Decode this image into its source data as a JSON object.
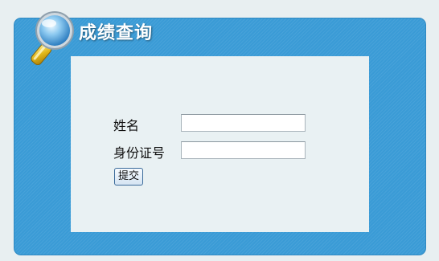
{
  "header": {
    "title": "成绩查询",
    "icon": "magnifier-icon"
  },
  "form": {
    "name_label": "姓名",
    "name_value": "",
    "id_label": "身份证号",
    "id_value": "",
    "submit_label": "提交"
  },
  "colors": {
    "panel_blue": "#3a9bd6",
    "content_background": "#e9f1f3",
    "page_background": "#e8eff1"
  }
}
